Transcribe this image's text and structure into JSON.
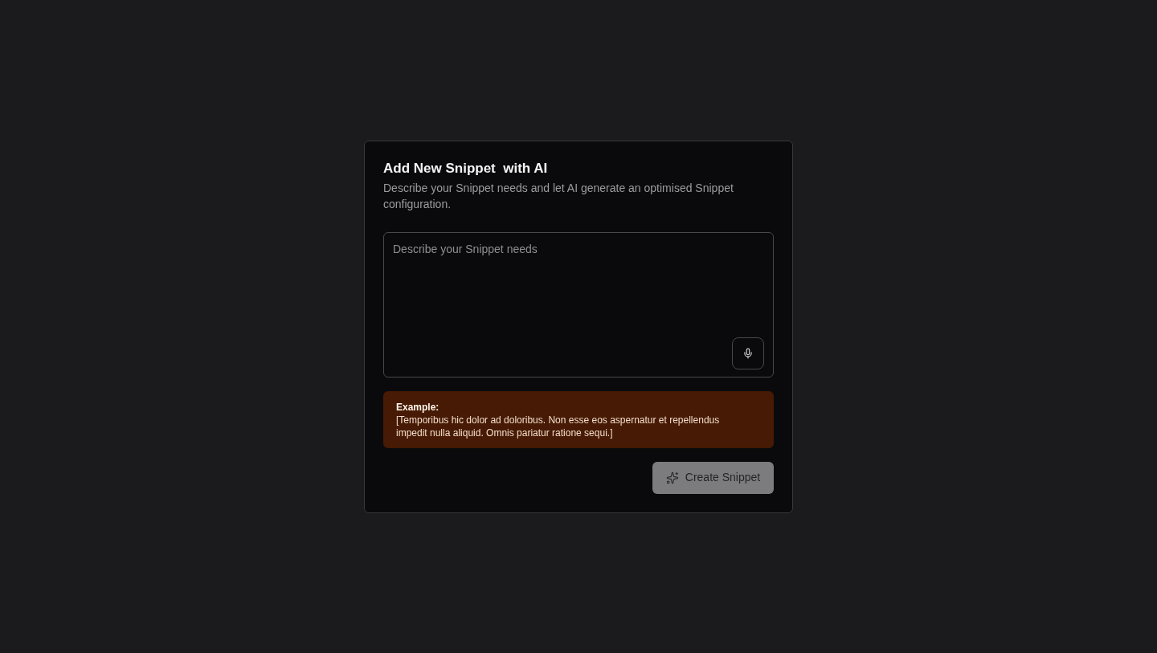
{
  "dialog": {
    "title": "Add New Snippet  with AI",
    "description": "Describe your Snippet needs and let AI generate an optimised Snippet configuration."
  },
  "prompt_field": {
    "placeholder": "Describe your Snippet needs"
  },
  "example": {
    "label": "Example:",
    "text": "[Temporibus hic dolor ad doloribus. Non esse eos aspernatur et repellendus impedit nulla aliquid. Omnis pariatur ratione sequi.]"
  },
  "create_button": {
    "label": "Create Snippet",
    "disabled": true
  }
}
